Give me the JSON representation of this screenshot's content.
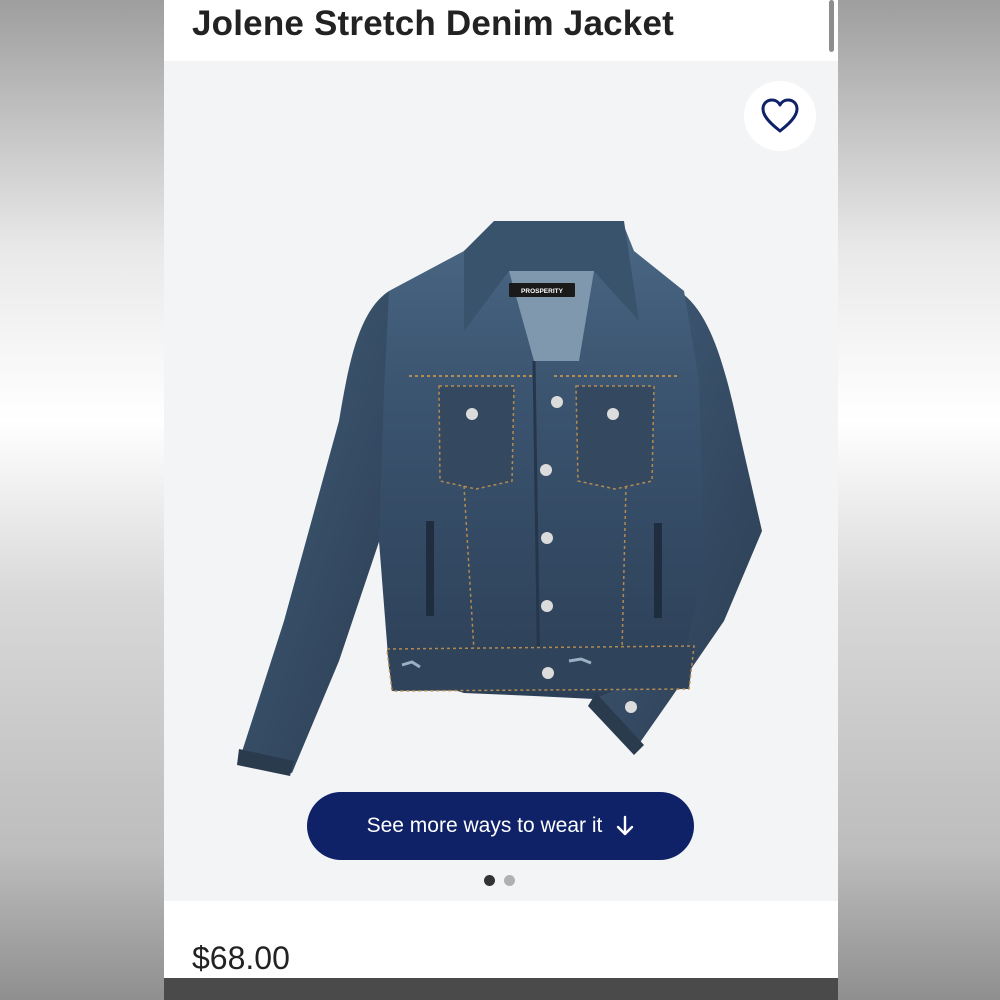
{
  "product": {
    "title": "Jolene Stretch Denim Jacket",
    "price": "$68.00",
    "brand_label": "PROSPERITY"
  },
  "hero": {
    "cta_label": "See more ways to wear it",
    "cta_icon": "arrow-down-icon",
    "favorite_icon": "heart-icon",
    "carousel": {
      "slides": 2,
      "active": 1
    }
  },
  "colors": {
    "accent": "#0f2167",
    "hero_background": "#f3f4f6",
    "text": "#222222"
  }
}
